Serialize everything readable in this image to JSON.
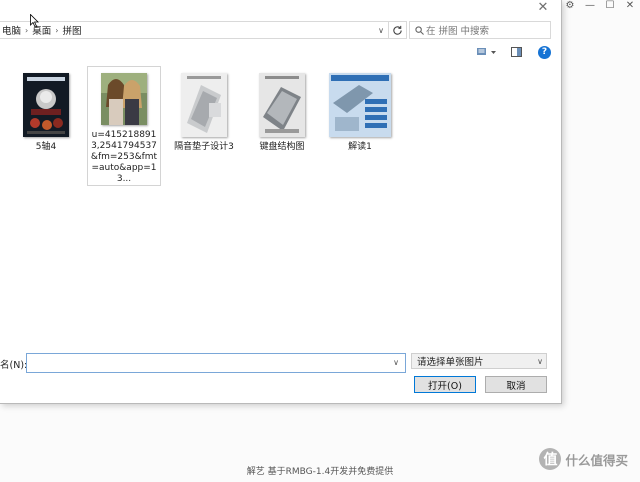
{
  "app": {
    "window_controls": [
      "settings",
      "minimize",
      "maximize",
      "close"
    ]
  },
  "dialog": {
    "address_bar": {
      "crumbs": [
        "电脑",
        "桌面",
        "拼图"
      ]
    },
    "search": {
      "placeholder": "在 拼图 中搜索"
    },
    "files": [
      {
        "label": "5轴4",
        "thumb": "poster-dark"
      },
      {
        "label": "u=4152188913,2541794537&fm=253&fmt=auto&app=13...",
        "thumb": "photo-girls",
        "selected": true
      },
      {
        "label": "隔音垫子设计3",
        "thumb": "doc-gray"
      },
      {
        "label": "键盘结构图",
        "thumb": "doc-gray2"
      },
      {
        "label": "解读1",
        "thumb": "doc-blue"
      }
    ],
    "filename": {
      "label": "名(N):",
      "value": ""
    },
    "filter": {
      "selected": "请选择单张图片"
    },
    "buttons": {
      "open": "打开(O)",
      "cancel": "取消"
    }
  },
  "footer": {
    "text": "解艺 基于RMBG-1.4开发并免费提供"
  },
  "watermark": {
    "badge": "值",
    "text": "什么值得买"
  },
  "colors": {
    "accent": "#0078d7",
    "help_icon": "#1673d4"
  }
}
